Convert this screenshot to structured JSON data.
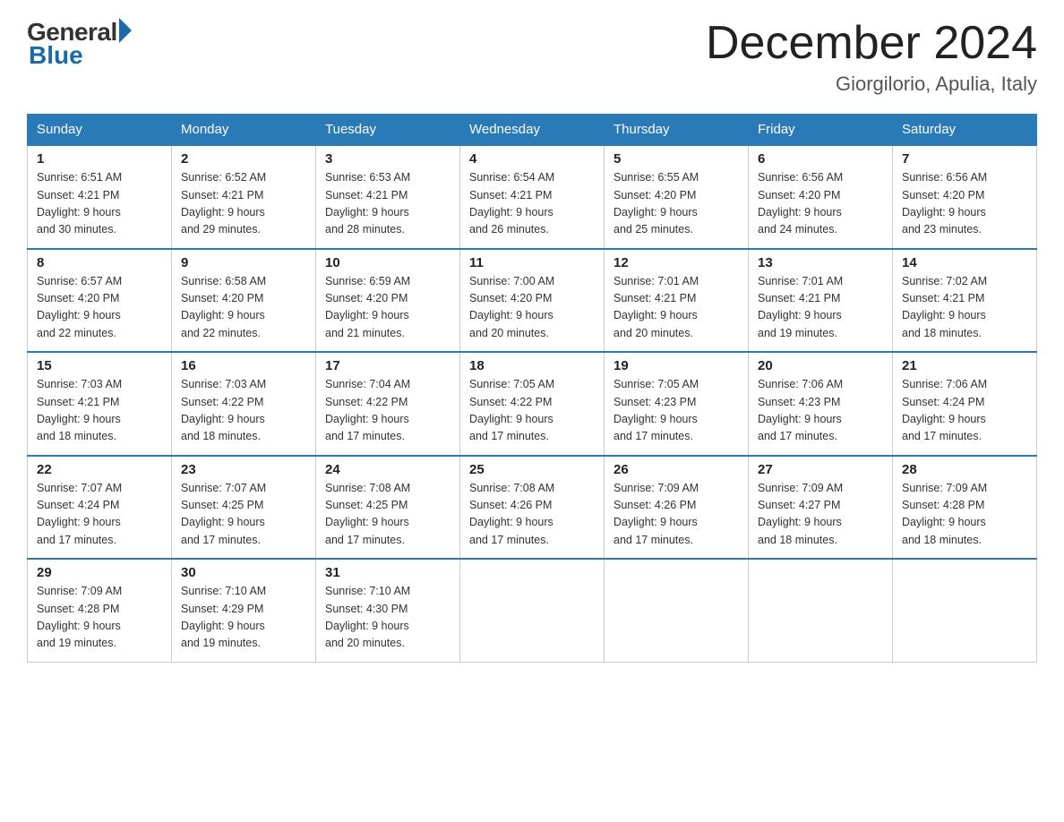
{
  "header": {
    "logo_general": "General",
    "logo_blue": "Blue",
    "title": "December 2024",
    "subtitle": "Giorgilorio, Apulia, Italy"
  },
  "days_of_week": [
    "Sunday",
    "Monday",
    "Tuesday",
    "Wednesday",
    "Thursday",
    "Friday",
    "Saturday"
  ],
  "weeks": [
    [
      {
        "day": "1",
        "sunrise": "6:51 AM",
        "sunset": "4:21 PM",
        "daylight": "9 hours and 30 minutes."
      },
      {
        "day": "2",
        "sunrise": "6:52 AM",
        "sunset": "4:21 PM",
        "daylight": "9 hours and 29 minutes."
      },
      {
        "day": "3",
        "sunrise": "6:53 AM",
        "sunset": "4:21 PM",
        "daylight": "9 hours and 28 minutes."
      },
      {
        "day": "4",
        "sunrise": "6:54 AM",
        "sunset": "4:21 PM",
        "daylight": "9 hours and 26 minutes."
      },
      {
        "day": "5",
        "sunrise": "6:55 AM",
        "sunset": "4:20 PM",
        "daylight": "9 hours and 25 minutes."
      },
      {
        "day": "6",
        "sunrise": "6:56 AM",
        "sunset": "4:20 PM",
        "daylight": "9 hours and 24 minutes."
      },
      {
        "day": "7",
        "sunrise": "6:56 AM",
        "sunset": "4:20 PM",
        "daylight": "9 hours and 23 minutes."
      }
    ],
    [
      {
        "day": "8",
        "sunrise": "6:57 AM",
        "sunset": "4:20 PM",
        "daylight": "9 hours and 22 minutes."
      },
      {
        "day": "9",
        "sunrise": "6:58 AM",
        "sunset": "4:20 PM",
        "daylight": "9 hours and 22 minutes."
      },
      {
        "day": "10",
        "sunrise": "6:59 AM",
        "sunset": "4:20 PM",
        "daylight": "9 hours and 21 minutes."
      },
      {
        "day": "11",
        "sunrise": "7:00 AM",
        "sunset": "4:20 PM",
        "daylight": "9 hours and 20 minutes."
      },
      {
        "day": "12",
        "sunrise": "7:01 AM",
        "sunset": "4:21 PM",
        "daylight": "9 hours and 20 minutes."
      },
      {
        "day": "13",
        "sunrise": "7:01 AM",
        "sunset": "4:21 PM",
        "daylight": "9 hours and 19 minutes."
      },
      {
        "day": "14",
        "sunrise": "7:02 AM",
        "sunset": "4:21 PM",
        "daylight": "9 hours and 18 minutes."
      }
    ],
    [
      {
        "day": "15",
        "sunrise": "7:03 AM",
        "sunset": "4:21 PM",
        "daylight": "9 hours and 18 minutes."
      },
      {
        "day": "16",
        "sunrise": "7:03 AM",
        "sunset": "4:22 PM",
        "daylight": "9 hours and 18 minutes."
      },
      {
        "day": "17",
        "sunrise": "7:04 AM",
        "sunset": "4:22 PM",
        "daylight": "9 hours and 17 minutes."
      },
      {
        "day": "18",
        "sunrise": "7:05 AM",
        "sunset": "4:22 PM",
        "daylight": "9 hours and 17 minutes."
      },
      {
        "day": "19",
        "sunrise": "7:05 AM",
        "sunset": "4:23 PM",
        "daylight": "9 hours and 17 minutes."
      },
      {
        "day": "20",
        "sunrise": "7:06 AM",
        "sunset": "4:23 PM",
        "daylight": "9 hours and 17 minutes."
      },
      {
        "day": "21",
        "sunrise": "7:06 AM",
        "sunset": "4:24 PM",
        "daylight": "9 hours and 17 minutes."
      }
    ],
    [
      {
        "day": "22",
        "sunrise": "7:07 AM",
        "sunset": "4:24 PM",
        "daylight": "9 hours and 17 minutes."
      },
      {
        "day": "23",
        "sunrise": "7:07 AM",
        "sunset": "4:25 PM",
        "daylight": "9 hours and 17 minutes."
      },
      {
        "day": "24",
        "sunrise": "7:08 AM",
        "sunset": "4:25 PM",
        "daylight": "9 hours and 17 minutes."
      },
      {
        "day": "25",
        "sunrise": "7:08 AM",
        "sunset": "4:26 PM",
        "daylight": "9 hours and 17 minutes."
      },
      {
        "day": "26",
        "sunrise": "7:09 AM",
        "sunset": "4:26 PM",
        "daylight": "9 hours and 17 minutes."
      },
      {
        "day": "27",
        "sunrise": "7:09 AM",
        "sunset": "4:27 PM",
        "daylight": "9 hours and 18 minutes."
      },
      {
        "day": "28",
        "sunrise": "7:09 AM",
        "sunset": "4:28 PM",
        "daylight": "9 hours and 18 minutes."
      }
    ],
    [
      {
        "day": "29",
        "sunrise": "7:09 AM",
        "sunset": "4:28 PM",
        "daylight": "9 hours and 19 minutes."
      },
      {
        "day": "30",
        "sunrise": "7:10 AM",
        "sunset": "4:29 PM",
        "daylight": "9 hours and 19 minutes."
      },
      {
        "day": "31",
        "sunrise": "7:10 AM",
        "sunset": "4:30 PM",
        "daylight": "9 hours and 20 minutes."
      },
      null,
      null,
      null,
      null
    ]
  ],
  "labels": {
    "sunrise": "Sunrise:",
    "sunset": "Sunset:",
    "daylight": "Daylight:"
  }
}
